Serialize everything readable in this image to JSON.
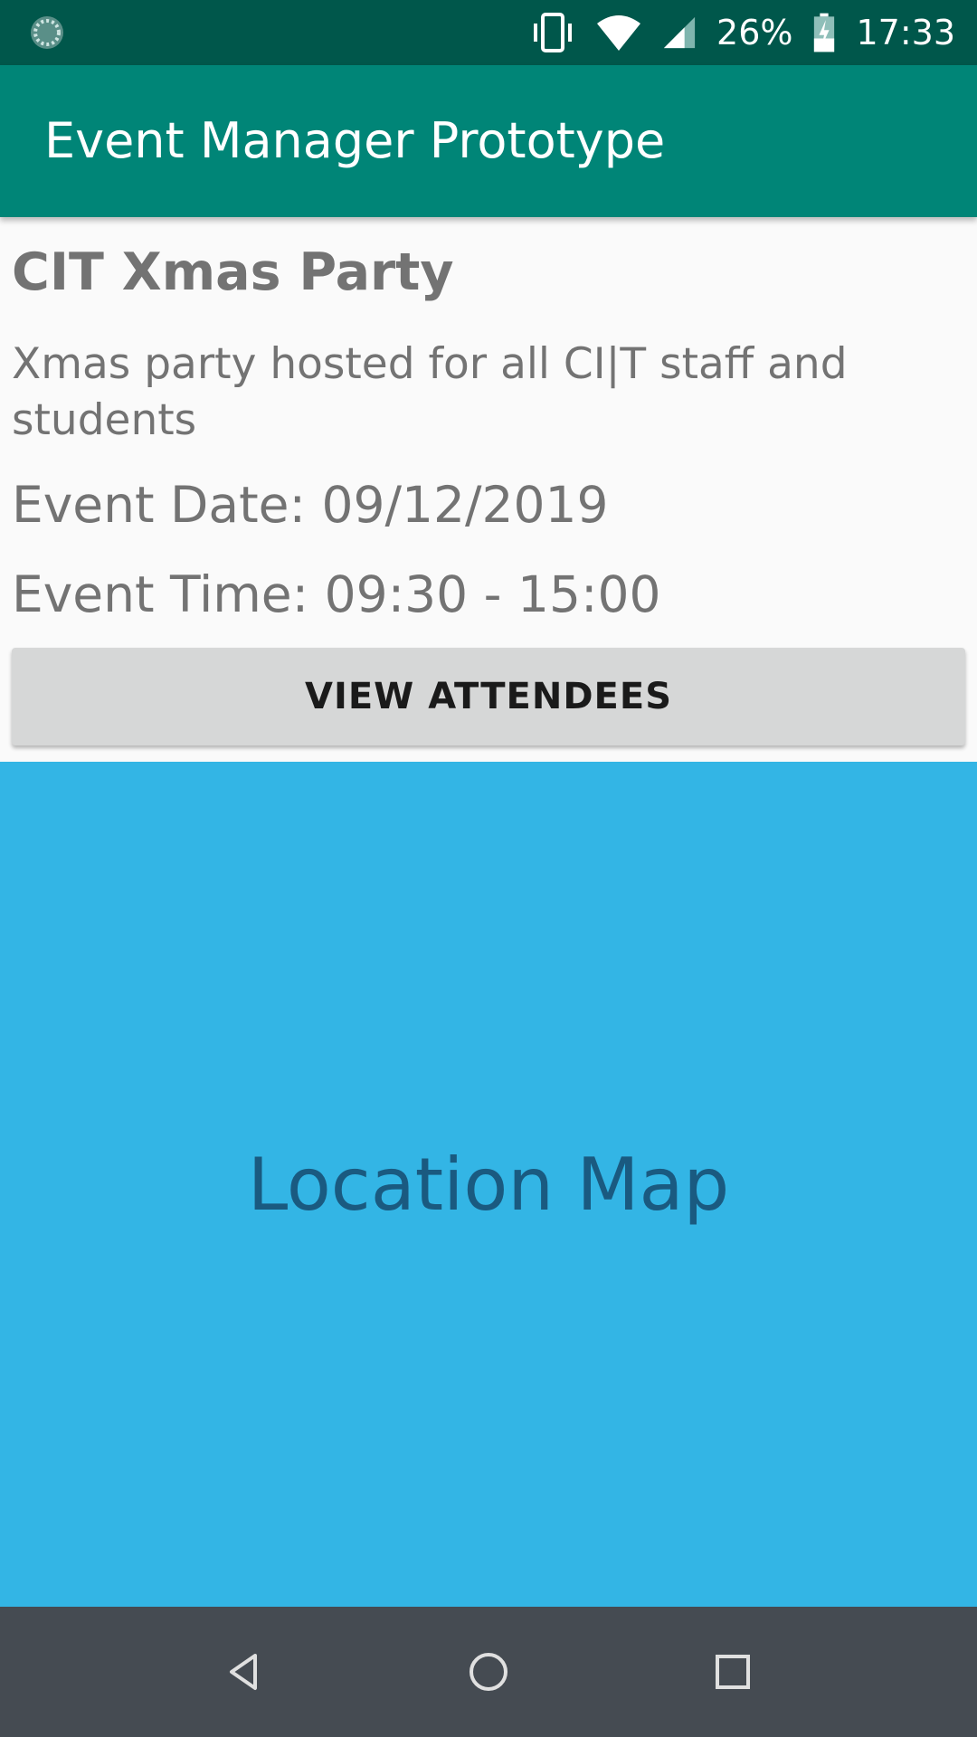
{
  "status_bar": {
    "battery": "26%",
    "time": "17:33",
    "icons": [
      "loading-icon",
      "vibrate-icon",
      "wifi-icon",
      "cell-signal-icon",
      "battery-charging-icon"
    ]
  },
  "app_bar": {
    "title": "Event Manager Prototype"
  },
  "event": {
    "title": "CIT Xmas Party",
    "description": "Xmas party hosted for all CI|T staff and students",
    "date": "Event Date: 09/12/2019",
    "time": "Event Time: 09:30 - 15:00"
  },
  "actions": {
    "view_attendees": "VIEW ATTENDEES"
  },
  "map": {
    "label": "Location Map"
  },
  "nav_bar": {
    "icons": [
      "back-icon",
      "home-icon",
      "recents-icon"
    ]
  },
  "colors": {
    "status_bar": "#00574b",
    "app_bar": "#008577",
    "map": "#33b5e5",
    "nav_bar": "#454b52"
  }
}
